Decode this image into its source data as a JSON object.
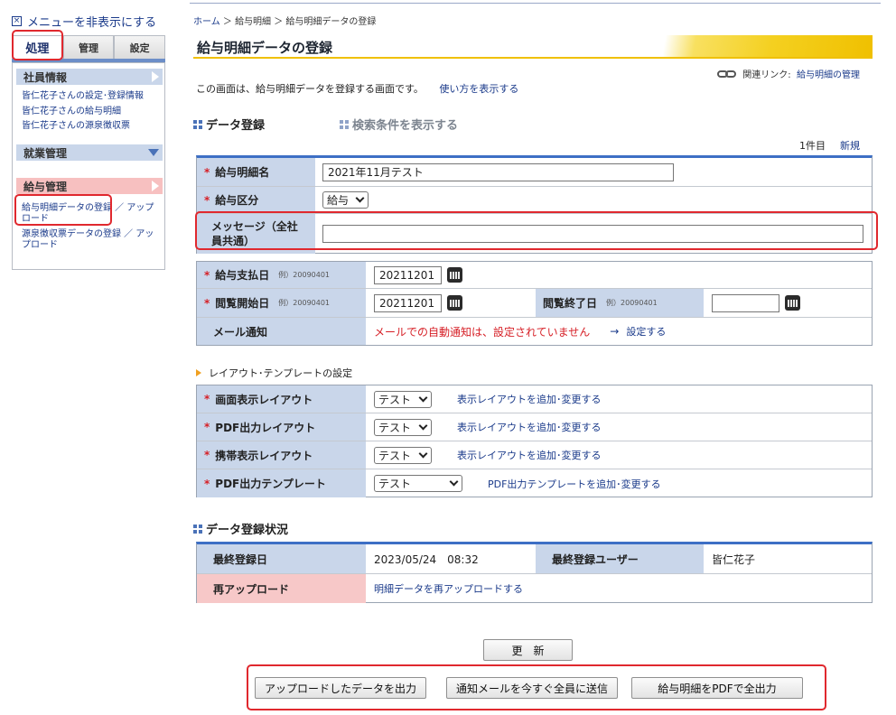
{
  "sidebar": {
    "hide_menu": "メニューを非表示にする",
    "tabs": [
      "処理",
      "管理",
      "設定"
    ],
    "employee_info": {
      "title": "社員情報",
      "links": [
        "皆仁花子さんの設定･登録情報",
        "皆仁花子さんの給与明細",
        "皆仁花子さんの源泉徴収票"
      ]
    },
    "attendance": {
      "title": "就業管理"
    },
    "payroll": {
      "title": "給与管理",
      "links": [
        {
          "main": "給与明細データの登録",
          "rest": " ／ アップロード"
        },
        {
          "main": "源泉徴収票データの登録",
          "rest": " ／ アップロード"
        }
      ]
    }
  },
  "breadcrumb": {
    "home": "ホーム",
    "sep": " ＞ ",
    "level1": "給与明細",
    "level2": "給与明細データの登録"
  },
  "page_title": "給与明細データの登録",
  "related": {
    "label": "関連リンク:",
    "link": "給与明細の管理"
  },
  "intro": {
    "text": "この画面は、給与明細データを登録する画面です。",
    "link": "使い方を表示する"
  },
  "section_data_entry": "データ登録",
  "section_search_toggle": "検索条件を表示する",
  "count": {
    "text": "1件目",
    "new": "新規"
  },
  "form1": {
    "payslip_name": {
      "label": "給与明細名",
      "value": "2021年11月テスト"
    },
    "salary_type": {
      "label": "給与区分",
      "value": "給与"
    },
    "message": {
      "label": "メッセージ（全社員共通）",
      "value": ""
    }
  },
  "form2": {
    "pay_date": {
      "label": "給与支払日",
      "hint": "例）20090401",
      "value": "20211201"
    },
    "view_start": {
      "label": "閲覧開始日",
      "hint": "例）20090401",
      "value": "20211201"
    },
    "view_end": {
      "label": "閲覧終了日",
      "hint": "例）20090401",
      "value": ""
    },
    "mail": {
      "label": "メール通知",
      "value": "メールでの自動通知は、設定されていません",
      "arrow": "→",
      "link": "設定する"
    }
  },
  "layout_section": "レイアウト･テンプレートの設定",
  "layouts": [
    {
      "label": "画面表示レイアウト",
      "value": "テスト",
      "link": "表示レイアウトを追加･変更する"
    },
    {
      "label": "PDF出力レイアウト",
      "value": "テスト",
      "link": "表示レイアウトを追加･変更する"
    },
    {
      "label": "携帯表示レイアウト",
      "value": "テスト",
      "link": "表示レイアウトを追加･変更する"
    },
    {
      "label": "PDF出力テンプレート",
      "value": "テスト",
      "link": "PDF出力テンプレートを追加･変更する"
    }
  ],
  "status_section": "データ登録状況",
  "status": {
    "last_date_label": "最終登録日",
    "last_date_value": "2023/05/24　08:32",
    "last_user_label": "最終登録ユーザー",
    "last_user_value": "皆仁花子",
    "reupload_label": "再アップロード",
    "reupload_link": "明細データを再アップロードする"
  },
  "buttons": {
    "update": "更　新",
    "export_uploaded": "アップロードしたデータを出力",
    "send_mail_all": "通知メールを今すぐ全員に送信",
    "pdf_all": "給与明細をPDFで全出力"
  },
  "colors": {
    "accent_blue": "#3d6fc5",
    "label_blue": "#c9d6ea",
    "label_pink": "#f7c8c8",
    "required_red": "#d61f26",
    "highlight_red": "#e0282e",
    "title_yellow": "#f0c000"
  }
}
